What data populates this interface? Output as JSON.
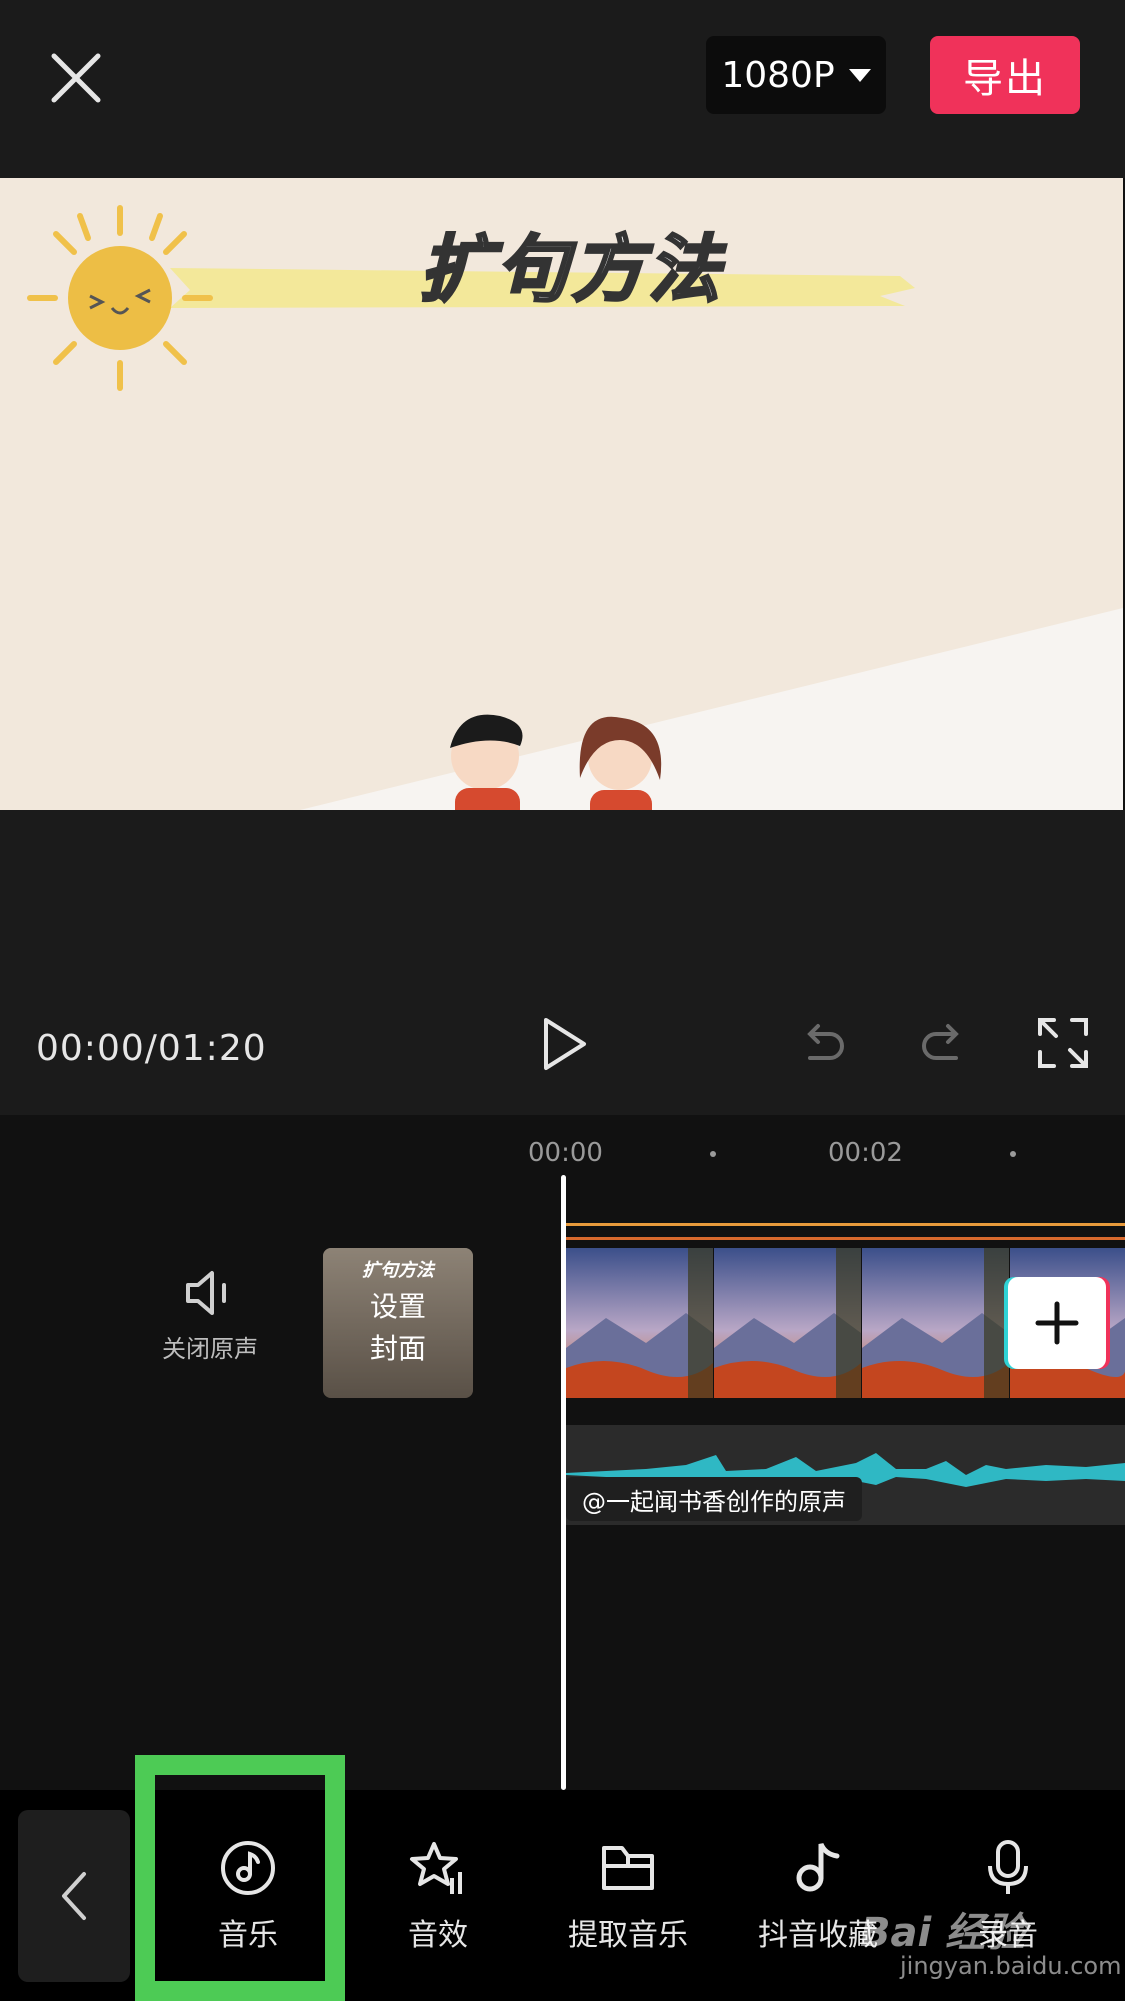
{
  "header": {
    "resolution_label": "1080P",
    "export_label": "导出"
  },
  "preview": {
    "video_title": "扩句方法"
  },
  "playback": {
    "timecode": "00:00/01:20"
  },
  "timeline": {
    "ticks": [
      "00:00",
      "00:02"
    ],
    "mute_label": "关闭原声",
    "cover_title": "扩句方法",
    "cover_label_line1": "设置",
    "cover_label_line2": "封面",
    "audio_label": "@一起闻书香创作的原声"
  },
  "toolbar": {
    "items": [
      {
        "label": "音乐",
        "icon": "music-icon",
        "selected": true
      },
      {
        "label": "音效",
        "icon": "sound-effect-icon"
      },
      {
        "label": "提取音乐",
        "icon": "folder-icon"
      },
      {
        "label": "抖音收藏",
        "icon": "douyin-icon"
      },
      {
        "label": "录音",
        "icon": "microphone-icon"
      }
    ]
  },
  "watermark": {
    "text": "Bai 经验",
    "sub": "jingyan.baidu.com"
  },
  "colors": {
    "accent": "#f0325a",
    "highlight": "#4dcb55",
    "waveform": "#2fb8c4",
    "timeline_marker": "#e79a3b"
  }
}
